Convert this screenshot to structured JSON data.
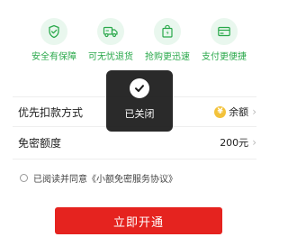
{
  "features": [
    {
      "label": "安全有保障",
      "icon": "shield-check-icon"
    },
    {
      "label": "可无忧退货",
      "icon": "delivery-truck-icon"
    },
    {
      "label": "抢购更迅速",
      "icon": "shopping-bag-icon"
    },
    {
      "label": "支付更便捷",
      "icon": "credit-card-icon"
    }
  ],
  "colors": {
    "feature_green": "#29a84a",
    "feature_bg": "#e9f7ee",
    "button_red": "#e5231f",
    "coin_gold": "#f3c23a"
  },
  "payment_method": {
    "label": "优先扣款方式",
    "value": "余额",
    "icon": "coin-icon"
  },
  "limit": {
    "label": "免密额度",
    "value": "200元"
  },
  "agreement": {
    "text": "已阅读并同意《小额免密服务协议》"
  },
  "toast": {
    "text": "已关闭",
    "icon": "checkmark-icon"
  },
  "submit": {
    "label": "立即开通"
  }
}
